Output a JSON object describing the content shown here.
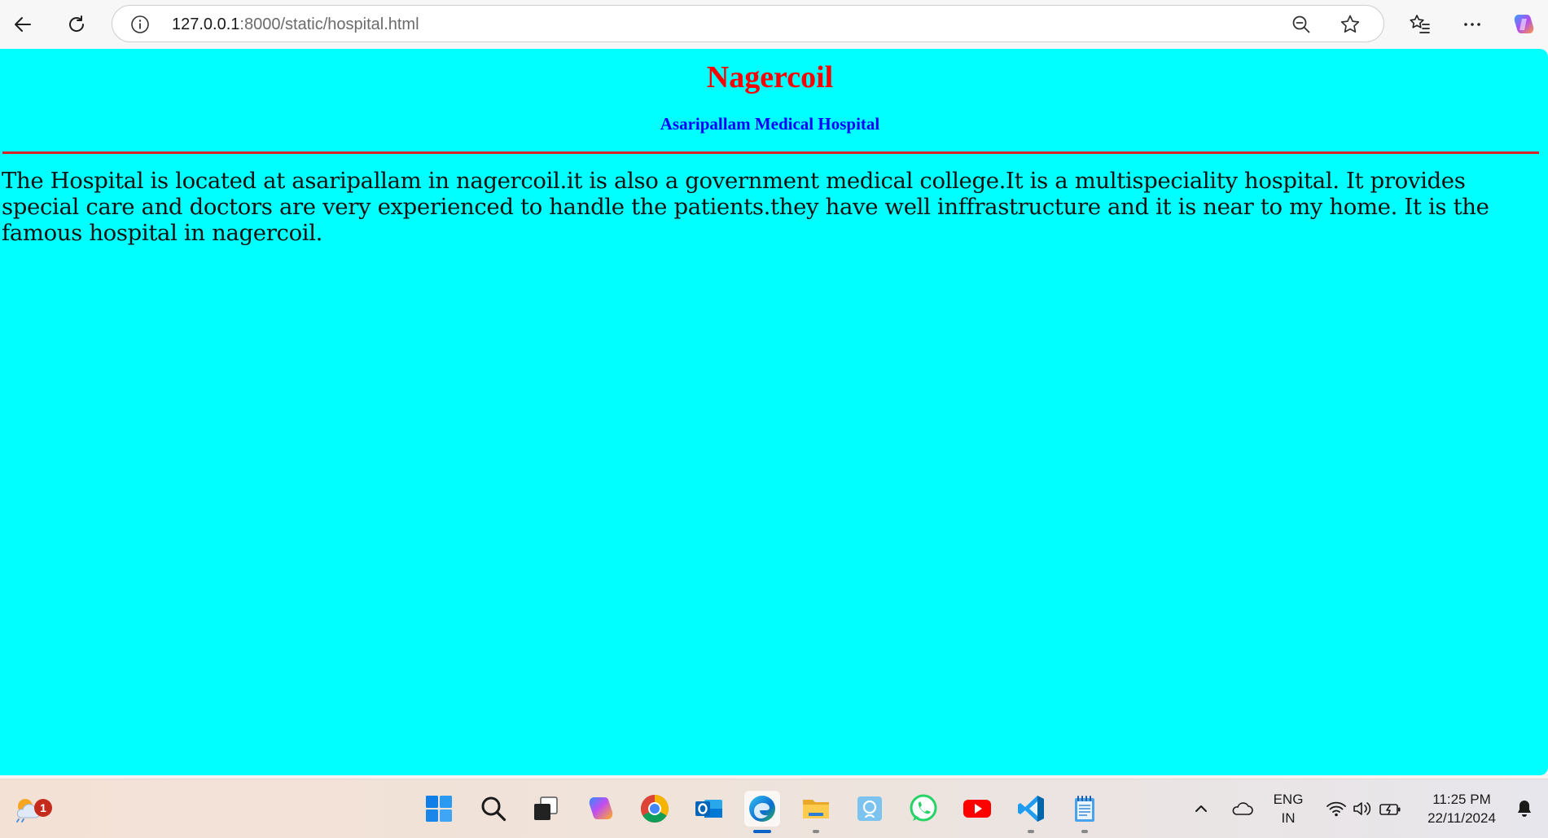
{
  "browser": {
    "url_host": "127.0.0.1",
    "url_path": ":8000/static/hospital.html"
  },
  "page": {
    "heading": "Nagercoil",
    "subheading": "Asaripallam Medical Hospital",
    "paragraph": "The Hospital is located at asaripallam in nagercoil.it is also a government medical college.It is a multispeciality hospital. It provides special care and doctors are very experienced to handle the patients.they have well inffrastructure and it is near to my home. It is the famous hospital in nagercoil.",
    "background_color": "#00ffff",
    "heading_color": "#ff0000",
    "subheading_color": "#0000ff",
    "rule_color": "#d8232a"
  },
  "taskbar": {
    "weather_badge": "1",
    "language_line1": "ENG",
    "language_line2": "IN",
    "time": "11:25 PM",
    "date": "22/11/2024",
    "apps": [
      "start-icon",
      "search-icon",
      "task-view-icon",
      "copilot-icon",
      "chrome-icon",
      "outlook-icon",
      "edge-icon",
      "file-explorer-icon",
      "photos-icon",
      "whatsapp-icon",
      "youtube-icon",
      "vscode-icon",
      "notepad-icon"
    ]
  }
}
